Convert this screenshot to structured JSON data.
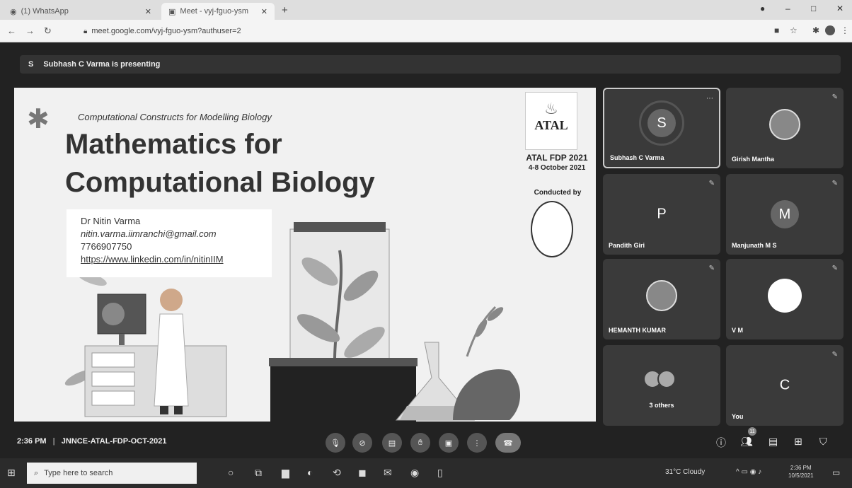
{
  "browser": {
    "tabs": [
      {
        "label": "(1) WhatsApp"
      },
      {
        "label": "Meet - vyj-fguo-ysm"
      }
    ],
    "url": "meet.google.com/vyj-fguo-ysm?authuser=2"
  },
  "meet": {
    "presenting_text": "Subhash C Varma is presenting",
    "meeting_time": "2:36 PM",
    "meeting_code": "JNNCE-ATAL-FDP-OCT-2021",
    "participant_count_badge": "11",
    "accent_color": "#3a3a3a"
  },
  "slide": {
    "subtitle": "Computational Constructs for Modelling Biology",
    "title_line1": "Mathematics for",
    "title_line2": "Computational Biology",
    "presenter_name": "Dr Nitin Varma",
    "presenter_email": "nitin.varma.iimranchi@gmail.com",
    "presenter_phone": "7766907750",
    "presenter_link": "https://www.linkedin.com/in/nitinIIM",
    "logo_text": "ATAL",
    "fdp_title": "ATAL FDP 2021",
    "fdp_dates": "4-8 October 2021",
    "conducted_by": "Conducted by"
  },
  "participants": [
    {
      "name": "Subhash C Varma",
      "initial": "S"
    },
    {
      "name": "Girish Mantha"
    },
    {
      "name": "Pandith Giri",
      "initial": "P"
    },
    {
      "name": "Manjunath M S",
      "initial": "M"
    },
    {
      "name": "HEMANTH KUMAR"
    },
    {
      "name": "V M"
    },
    {
      "label": "3 others"
    },
    {
      "name": "You",
      "initial": "C"
    }
  ],
  "taskbar": {
    "search_placeholder": "Type here to search",
    "weather": "31°C Cloudy",
    "time": "2:36 PM",
    "date": "10/5/2021"
  }
}
